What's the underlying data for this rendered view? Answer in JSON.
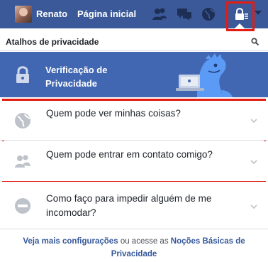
{
  "topbar": {
    "user_name": "Renato",
    "home_label": "Página inicial"
  },
  "header": {
    "title": "Atalhos de privacidade"
  },
  "banner": {
    "title": "Verificação de Privacidade"
  },
  "items": [
    {
      "label": "Quem pode ver minhas coisas?",
      "icon": "globe-icon"
    },
    {
      "label": "Quem pode entrar em contato comigo?",
      "icon": "friends-icon"
    },
    {
      "label": "Como faço para impedir alguém de me incomodar?",
      "icon": "block-icon"
    }
  ],
  "footer": {
    "more_settings_link": "Veja mais configurações",
    "middle_text": "ou acesse as",
    "basics_link": "Noções Básicas de Privacidade"
  },
  "colors": {
    "brand_blue": "#3b5998",
    "banner_blue": "#4267b2",
    "highlight_red": "#e41c12",
    "link_blue": "#365899"
  }
}
